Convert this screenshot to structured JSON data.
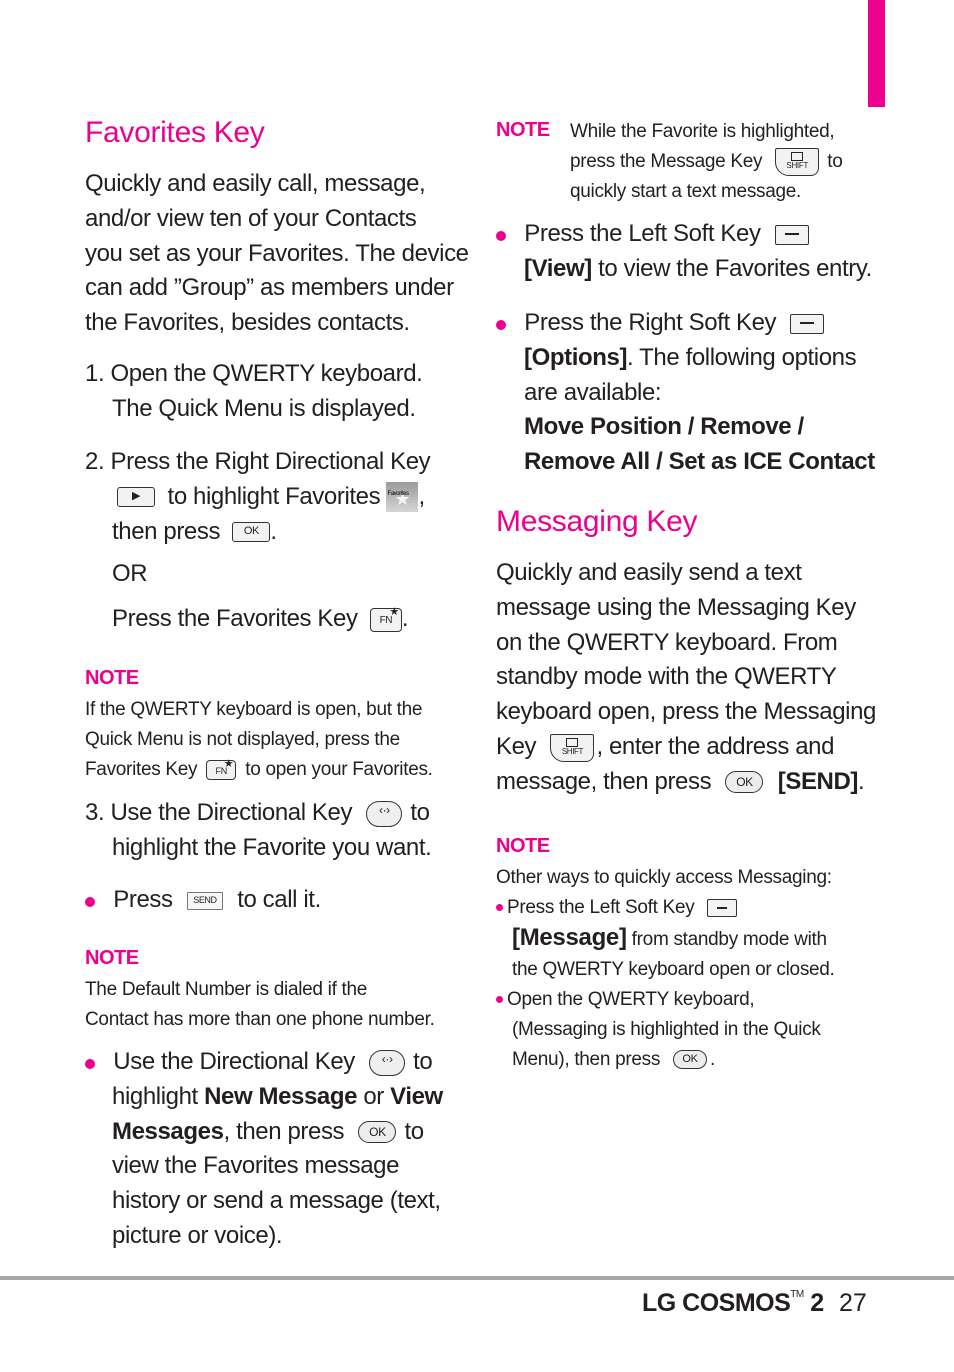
{
  "accent_color": "#ec008c",
  "left": {
    "favorites_heading": "Favorites Key",
    "intro_lines": [
      "Quickly and easily call, message,",
      "and/or view ten of your Contacts",
      "you set as your Favorites. The device",
      "can add ”Group” as members under",
      "the Favorites, besides contacts."
    ],
    "step1": {
      "num": "1.",
      "line1": "Open the QWERTY keyboard.",
      "line2": "The Quick Menu is displayed."
    },
    "step2": {
      "num": "2.",
      "line1": "Press the Right Directional Key",
      "line2_text": "to highlight Favorites",
      "line2_end": ",",
      "line3_text": "then press",
      "line3_end": ".",
      "or": "OR",
      "line5_text": "Press the Favorites Key",
      "line5_end": "."
    },
    "note1": {
      "label": "NOTE",
      "line1": "If the QWERTY keyboard is open, but the",
      "line2": "Quick Menu is not displayed, press the",
      "line3_a": "Favorites Key",
      "line3_b": "to open your Favorites."
    },
    "step3": {
      "num": "3.",
      "line1_a": "Use the Directional Key",
      "line1_b": "to",
      "line2": "highlight the Favorite you want."
    },
    "bullet_press": {
      "a": "Press",
      "b": "to call it."
    },
    "note2": {
      "label": "NOTE",
      "line1": "The Default Number is dialed if the",
      "line2": "Contact has more than one phone number."
    },
    "bullet_dir": {
      "line1_a": "Use the Directional Key",
      "line1_b": "to",
      "line2_a": "highlight ",
      "line2_b": "New Message",
      "line2_c": " or ",
      "line2_d": "View",
      "line3_a": "Messages",
      "line3_b": ", then press",
      "line3_c": "to",
      "line4": "view the Favorites message",
      "line5": "history or send a message (text,",
      "line6": "picture or voice)."
    }
  },
  "right": {
    "note3": {
      "label": "NOTE",
      "line1": "While the Favorite is highlighted,",
      "line2_a": "press the Message Key",
      "line2_b": "to",
      "line3": "quickly start a text message."
    },
    "bullet_left_soft": {
      "line1": "Press the Left Soft Key",
      "line2_b": "[View]",
      "line2_rest": " to view the Favorites entry."
    },
    "bullet_right_soft": {
      "line1": "Press the Right Soft Key",
      "line2_b": "[Options]",
      "line2_rest": ". The following options",
      "line3": "are available:",
      "line4": "Move Position / Remove /",
      "line5": "Remove All / Set as ICE Contact"
    },
    "messaging_heading": "Messaging Key",
    "msg_lines": [
      "Quickly and easily send a text",
      "message using the Messaging Key",
      "on the QWERTY keyboard. From",
      "standby mode with the QWERTY",
      "keyboard open, press the Messaging"
    ],
    "msg_line6_a": "Key",
    "msg_line6_b": ", enter the address and",
    "msg_line7_a": "message, then press",
    "msg_line7_b": "[SEND]",
    "msg_line7_c": ".",
    "note4": {
      "label": "NOTE",
      "line1": "Other ways to quickly access Messaging:",
      "b1_line1": "Press the Left Soft Key",
      "b1_line2_b": "[Message]",
      "b1_line2_rest": " from standby mode with",
      "b1_line3": "the QWERTY keyboard open or closed.",
      "b2_line1": "Open the QWERTY keyboard,",
      "b2_line2": "(Messaging is highlighted in the Quick",
      "b2_line3_a": "Menu), then press",
      "b2_line3_b": "."
    }
  },
  "keys": {
    "ok": "OK",
    "fn": "FN",
    "send": "SEND",
    "shift": "SHIFT",
    "right_arrow": "▶",
    "nav": "‹·›"
  },
  "footer": {
    "product": "LG COSMOS",
    "tm": "TM",
    "model": "2",
    "page": "27"
  }
}
